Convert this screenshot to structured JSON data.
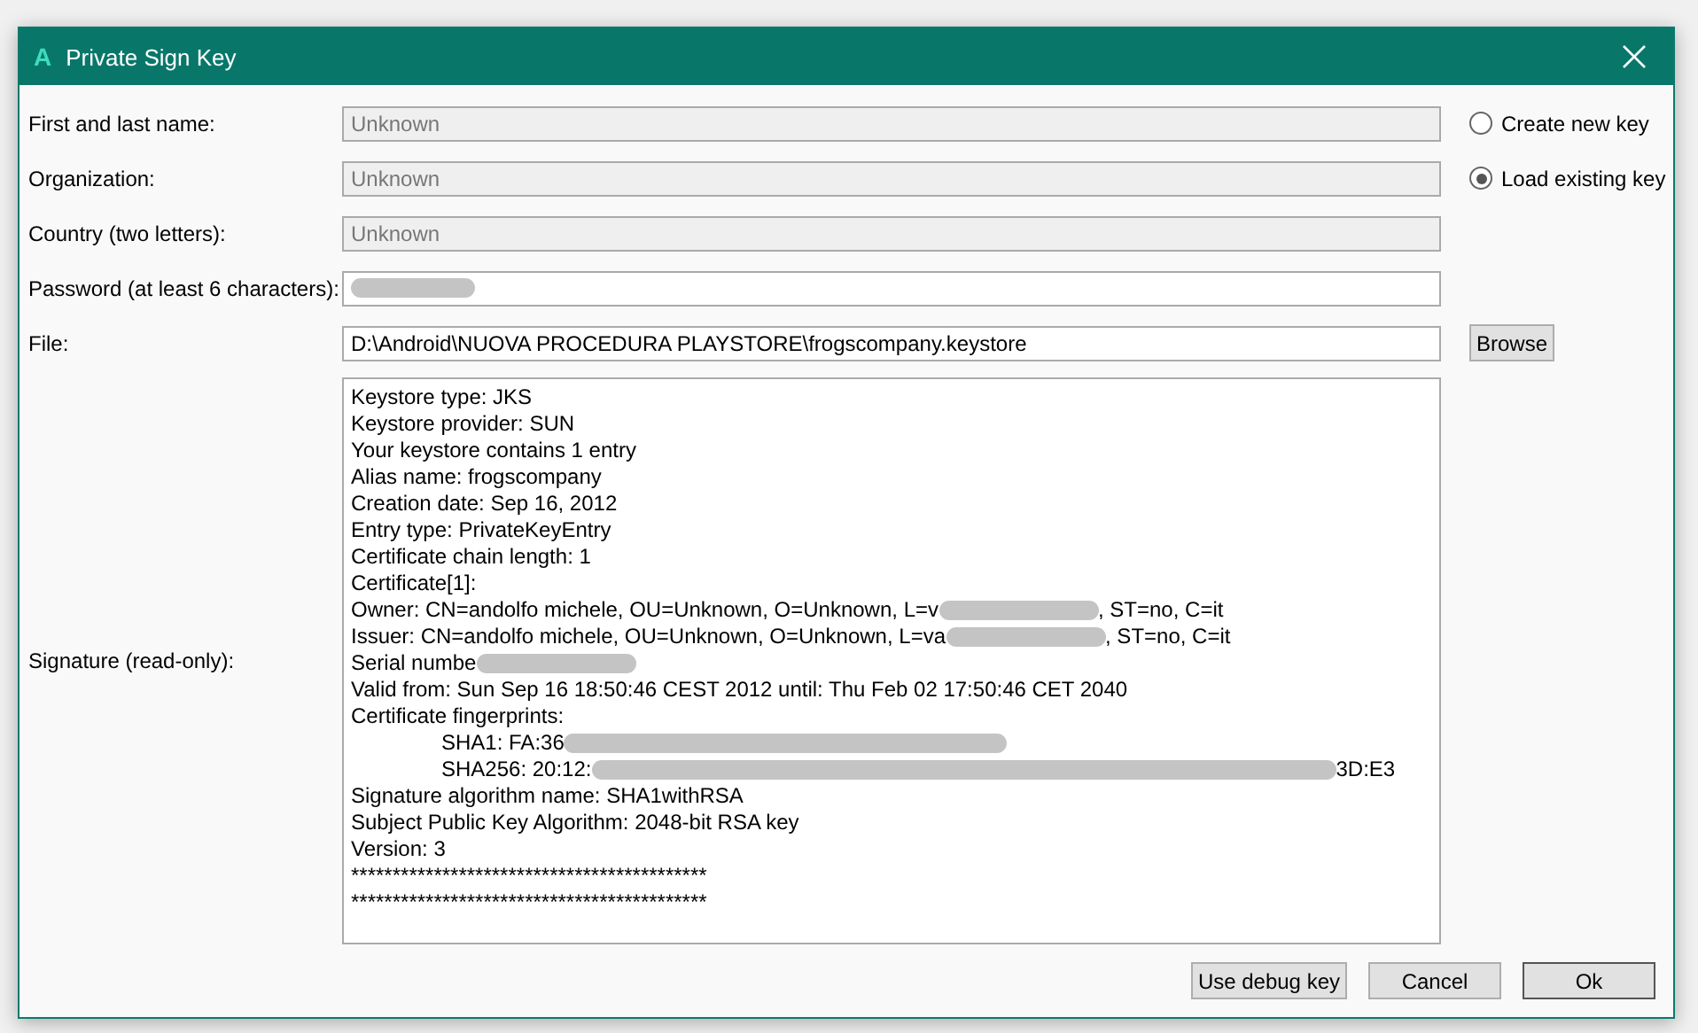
{
  "window": {
    "title": "Private Sign Key",
    "logo": "A"
  },
  "fields": [
    {
      "label": "First and last name:",
      "value": "Unknown",
      "disabled": true
    },
    {
      "label": "Organization:",
      "value": "Unknown",
      "disabled": true
    },
    {
      "label": "Country (two letters):",
      "value": "Unknown",
      "disabled": true
    },
    {
      "label": "Password (at least 6 characters):",
      "redacted": true,
      "disabled": false
    },
    {
      "label": "File:",
      "value": "D:\\Android\\NUOVA PROCEDURA PLAYSTORE\\frogscompany.keystore",
      "disabled": false,
      "button": "Browse"
    }
  ],
  "key_mode": [
    {
      "label": "Create new key",
      "selected": false
    },
    {
      "label": "Load existing key",
      "selected": true
    }
  ],
  "signature": {
    "label": "Signature (read-only):",
    "lines": [
      {
        "text": "Keystore type: JKS"
      },
      {
        "text": "Keystore provider: SUN"
      },
      {
        "text": "Your keystore contains 1 entry"
      },
      {
        "text": "Alias name: frogscompany"
      },
      {
        "text": "Creation date: Sep 16, 2012"
      },
      {
        "text": "Entry type: PrivateKeyEntry"
      },
      {
        "text": "Certificate chain length: 1"
      },
      {
        "text": "Certificate[1]:"
      },
      {
        "text": "Owner: CN=andolfo michele, OU=Unknown, O=Unknown, L=v",
        "redacted": true,
        "tail": ", ST=no, C=it"
      },
      {
        "text": "Issuer: CN=andolfo michele, OU=Unknown, O=Unknown, L=va",
        "redacted": true,
        "tail": ", ST=no, C=it"
      },
      {
        "text": "Serial numbe",
        "redacted": true
      },
      {
        "text": "Valid from: Sun Sep 16 18:50:46 CEST 2012 until: Thu Feb 02 17:50:46 CET 2040"
      },
      {
        "text": "Certificate fingerprints:",
        "children": [
          {
            "text": "SHA1: FA:36",
            "redacted": true
          },
          {
            "text": "SHA256: 20:12:",
            "redacted": true,
            "tail": "3D:E3"
          }
        ]
      },
      {
        "text": "Signature algorithm name: SHA1withRSA"
      },
      {
        "text": "Subject Public Key Algorithm: 2048-bit RSA key"
      },
      {
        "text": "Version: 3"
      },
      {
        "text": "*******************************************"
      },
      {
        "text": "*******************************************"
      }
    ]
  },
  "buttons": [
    {
      "label": "Use debug key",
      "default": false
    },
    {
      "label": "Cancel",
      "default": false
    },
    {
      "label": "Ok",
      "default": true
    }
  ]
}
